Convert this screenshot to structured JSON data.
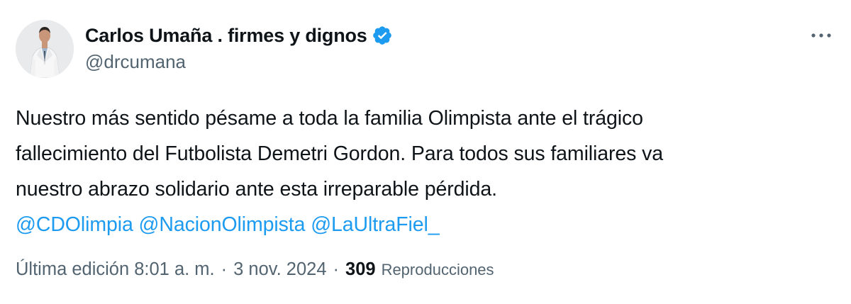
{
  "author": {
    "display_name": "Carlos Umaña . firmes y dignos",
    "handle": "@drcumana",
    "verified_icon": "verified-badge-icon",
    "verified_color": "#1d9bf0"
  },
  "tweet": {
    "lines": [
      "Nuestro más sentido pésame a toda la familia Olimpista ante el trágico",
      "fallecimiento del Futbolista Demetri Gordon. Para todos sus familiares va",
      "nuestro abrazo solidario ante esta irreparable pérdida."
    ],
    "mentions": [
      "@CDOlimpia",
      "@NacionOlimpista",
      "@LaUltraFiel_"
    ]
  },
  "meta": {
    "edited_time": "Última edición 8:01 a. m.",
    "separator": "·",
    "date": "3 nov. 2024",
    "views_count": "309",
    "views_label": "Reproducciones"
  },
  "colors": {
    "link": "#1d9bf0",
    "text": "#0f1419",
    "secondary": "#536471"
  },
  "icons": {
    "more": "more-options-icon"
  }
}
